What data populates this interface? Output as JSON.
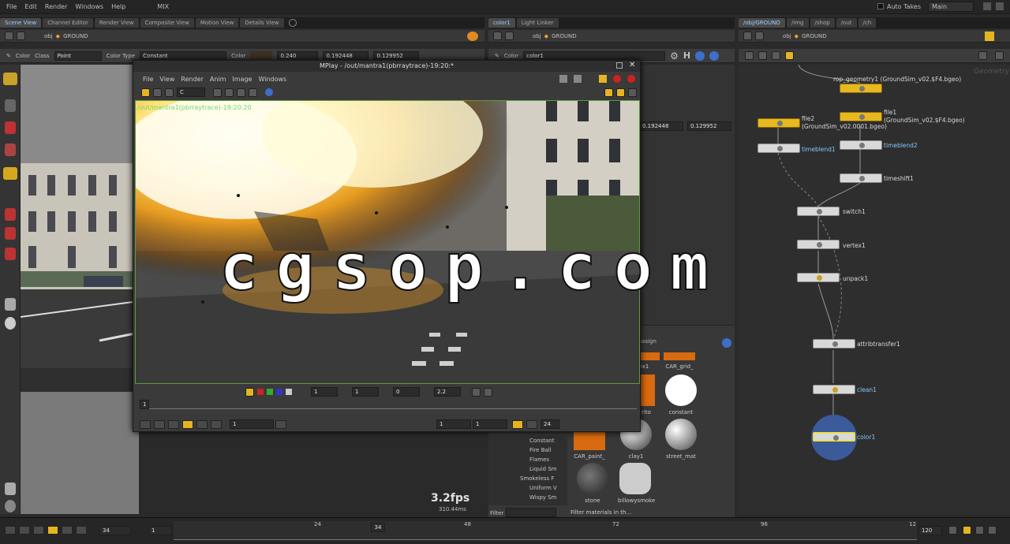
{
  "menu": [
    "File",
    "Edit",
    "Render",
    "Windows",
    "Help"
  ],
  "menu_mix": "MIX",
  "auto_takes": "Auto Takes",
  "desktop": "Main",
  "left_tabs": [
    "Scene View",
    "Channel Editor",
    "Render View",
    "Composite View",
    "Motion View",
    "Details View"
  ],
  "mid_tabs": [
    "color1",
    "Light Linker"
  ],
  "right_tabs": [
    "/obj/GROUND",
    "/img",
    "/shop",
    "/out",
    "/ch"
  ],
  "path": {
    "obj": "obj",
    "ground": "GROUND"
  },
  "params": {
    "color_label": "Color",
    "class_label": "Class",
    "class_value": "Point",
    "color_type_label": "Color Type",
    "color_type_value": "Constant",
    "color2_label": "Color",
    "r": "0.240",
    "g": "0.192448",
    "b": "0.129952"
  },
  "mid_params": {
    "color_label": "Color",
    "node_name": "color1",
    "g": "0.192448",
    "b": "0.129952"
  },
  "mplay": {
    "title": "MPlay - /out/mantra1(pbrraytrace)-19:20:*",
    "menus": [
      "File",
      "View",
      "Render",
      "Anim",
      "Image",
      "Windows"
    ],
    "plane": "C",
    "overlay": "/out/mantra1(pbrraytrace)-19:20:20",
    "frame_in": "1",
    "f1": "1",
    "f2": "1",
    "f3": "0",
    "gamma": "2.2",
    "frame_marker": "1",
    "cur_frame": "1",
    "start": "1",
    "end": "1",
    "fps": "24"
  },
  "watermark": "cgsop.com",
  "fps": {
    "value": "3.2fps",
    "ms": "310.44ms"
  },
  "nodes": [
    {
      "label": "rop_geometry1 (GroundSim_v02.$F4.bgeo)",
      "blue": false
    },
    {
      "label": "file2",
      "sub": "(GroundSim_v02.0001.bgeo)",
      "blue": false
    },
    {
      "label": "file1",
      "sub": "(GroundSim_v02.$F4.bgeo)",
      "blue": false
    },
    {
      "label": "timeblend1",
      "blue": true
    },
    {
      "label": "timeblend2",
      "blue": true
    },
    {
      "label": "timeshift1",
      "blue": false
    },
    {
      "label": "switch1",
      "blue": false
    },
    {
      "label": "vertex1",
      "blue": false
    },
    {
      "label": "unpack1",
      "blue": false
    },
    {
      "label": "attribtransfer1",
      "blue": false
    },
    {
      "label": "clean1",
      "blue": true
    },
    {
      "label": "color1",
      "blue": true
    }
  ],
  "geo_label": "Geometry",
  "materials": {
    "assign": "Assign",
    "items": [
      "CAR_grid_",
      "constant",
      "clay1",
      "street_mat",
      "CAR_paint_",
      "stone",
      "billowysmoke",
      "ex1",
      "rito"
    ],
    "list": [
      "Constant",
      "Fire Ball",
      "Flames",
      "Liquid Sm",
      "Smokeless F",
      "Uniform V",
      "Wispy Sm"
    ],
    "filter": "Filter",
    "filter_ph": "Filter materials in th..."
  },
  "timeline": {
    "frame": "34",
    "step": "1",
    "marker": "34",
    "ticks": [
      "24",
      "48",
      "72",
      "96",
      "12"
    ],
    "end": "120"
  }
}
